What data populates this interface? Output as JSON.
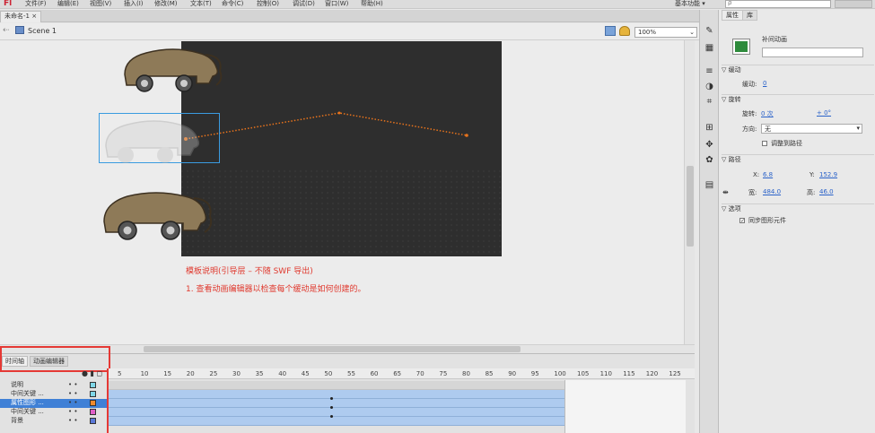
{
  "menu": {
    "logo": "Fl",
    "items": [
      "文件(F)",
      "编辑(E)",
      "视图(V)",
      "插入(I)",
      "修改(M)",
      "文本(T)",
      "命令(C)",
      "控制(O)",
      "调试(D)",
      "窗口(W)",
      "帮助(H)"
    ],
    "workspace": "基本功能 ▾",
    "search_placeholder": "ρ"
  },
  "document": {
    "tab_label": "未命名-1 ×",
    "scene_label": "Scene 1",
    "zoom": "100%"
  },
  "stage": {
    "note_title": "模板说明(引导层 – 不随 SWF 导出)",
    "note_line": "1. 查看动画编辑器以检查每个缓动是如何创建的。"
  },
  "timeline": {
    "tabs": [
      "时间轴",
      "动画编辑器"
    ],
    "ruler": [
      "5",
      "10",
      "15",
      "20",
      "25",
      "30",
      "35",
      "40",
      "45",
      "50",
      "55",
      "60",
      "65",
      "70",
      "75",
      "80",
      "85",
      "90",
      "95",
      "100",
      "105",
      "110",
      "115",
      "120",
      "125"
    ],
    "layers": [
      {
        "name": "说明",
        "color": "#7fd7e8"
      },
      {
        "name": "中间关键 ...",
        "color": "#7fd7e8"
      },
      {
        "name": "属性图形 ...",
        "color": "#f08a2c"
      },
      {
        "name": "中间关键 ...",
        "color": "#e060c8"
      },
      {
        "name": "背景",
        "color": "#5a78d8"
      }
    ]
  },
  "properties": {
    "tabs": [
      "属性",
      "库"
    ],
    "instance_type": "补间动画",
    "instance_name": "",
    "easing_section": "缓动",
    "easing_label": "缓动:",
    "easing_value": "0",
    "rotation_section": "旋转",
    "rotate_label": "旋转:",
    "rotate_value": "0 次",
    "rotate_plus": "+ 0°",
    "orient_label": "方向:",
    "orient_value": "无",
    "orient_to_path": "调整到路径",
    "pos_section": "路径",
    "x_label": "X:",
    "x_value": "6.8",
    "y_label": "Y:",
    "y_value": "152.9",
    "w_label": "宽:",
    "w_value": "484.0",
    "h_label": "高:",
    "h_value": "46.0",
    "options_section": "选项",
    "sync_label": "同步图形元件"
  }
}
